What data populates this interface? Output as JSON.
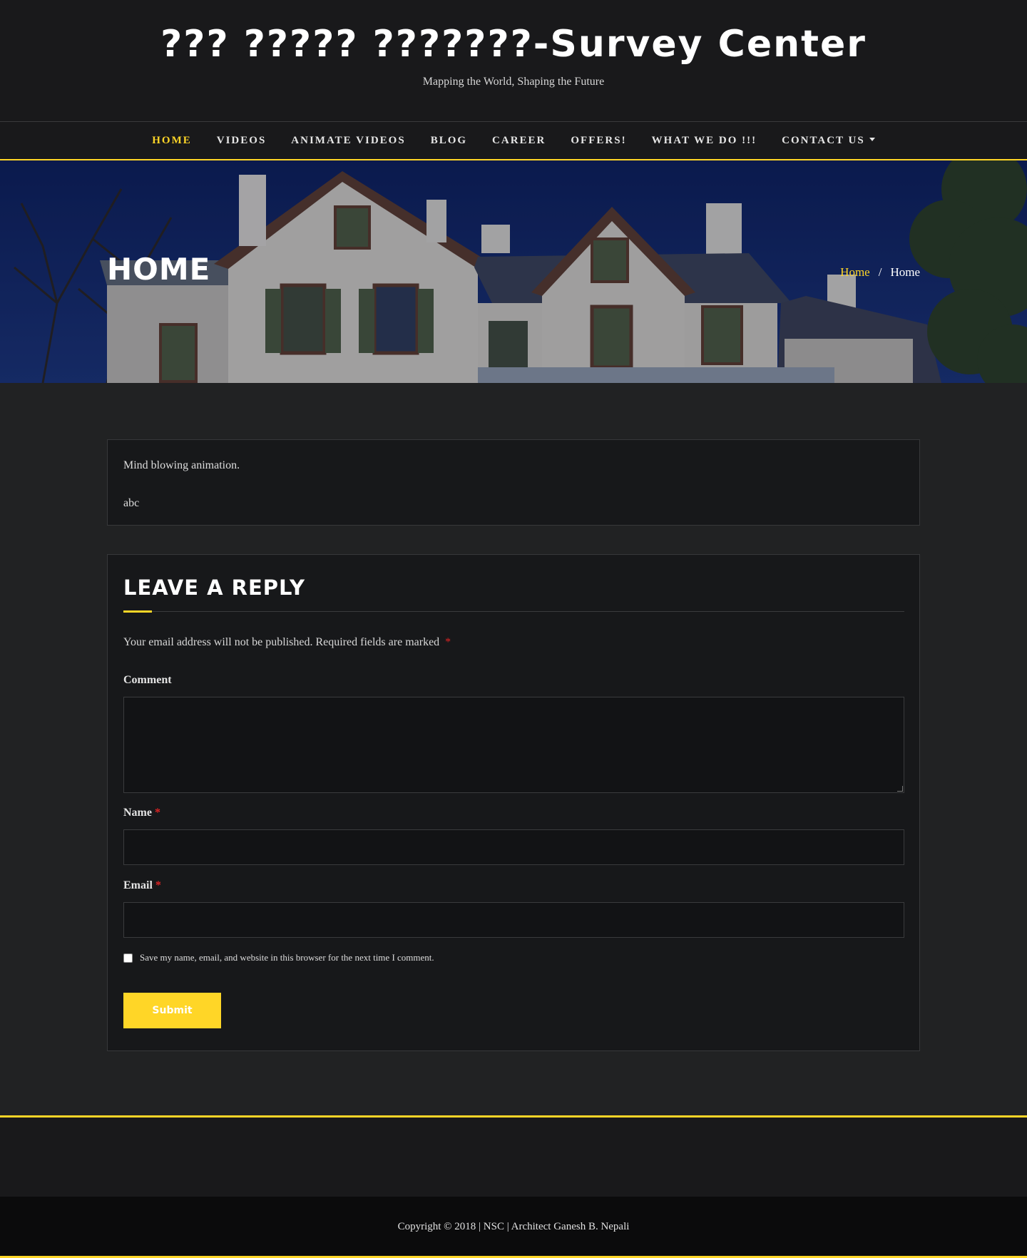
{
  "site": {
    "title": "??? ????? ???????-Survey Center",
    "tagline": "Mapping the World, Shaping the Future"
  },
  "nav": {
    "items": [
      {
        "label": "HOME",
        "active": true
      },
      {
        "label": "VIDEOS",
        "active": false
      },
      {
        "label": "ANIMATE VIDEOS",
        "active": false
      },
      {
        "label": "BLOG",
        "active": false
      },
      {
        "label": "CAREER",
        "active": false
      },
      {
        "label": "OFFERS!",
        "active": false
      },
      {
        "label": "WHAT WE DO !!!",
        "active": false
      },
      {
        "label": "CONTACT US",
        "active": false,
        "dropdown": true
      }
    ]
  },
  "hero": {
    "title": "HOME",
    "breadcrumb": {
      "link": "Home",
      "separator": "/",
      "current": "Home"
    }
  },
  "post": {
    "line1": "Mind blowing animation.",
    "line2": "abc"
  },
  "reply": {
    "title": "LEAVE A REPLY",
    "notes": "Your email address will not be published. Required fields are marked",
    "required_mark": "*",
    "comment_label": "Comment",
    "name_label": "Name",
    "email_label": "Email",
    "comment_value": "",
    "name_value": "",
    "email_value": "",
    "consent_label": "Save my name, email, and website in this browser for the next time I comment.",
    "submit_label": "Submit"
  },
  "footer": {
    "copyright": "Copyright © 2018 | NSC | Architect Ganesh B. Nepali"
  },
  "colors": {
    "accent": "#ffd627",
    "background": "#212223",
    "required": "#e02424"
  }
}
